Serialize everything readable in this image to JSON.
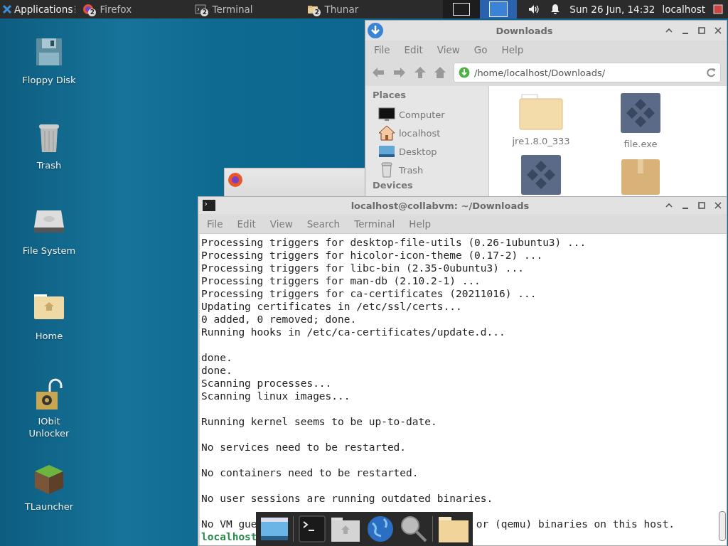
{
  "panel": {
    "applications": "Applications",
    "tasks": [
      {
        "label": "Firefox",
        "badge": "2",
        "kind": "firefox"
      },
      {
        "label": "Terminal",
        "badge": "2",
        "kind": "terminal"
      },
      {
        "label": "Thunar",
        "badge": "2",
        "kind": "folder"
      }
    ],
    "workspaces": [
      {
        "selected": false
      },
      {
        "selected": true
      }
    ],
    "clock": "Sun 26 Jun, 14:32",
    "user": "localhost"
  },
  "desktop_icons": [
    {
      "label": "Floppy Disk",
      "kind": "floppy"
    },
    {
      "label": "Trash",
      "kind": "trash"
    },
    {
      "label": "File System",
      "kind": "drive"
    },
    {
      "label": "Home",
      "kind": "home"
    },
    {
      "label": "IObit Unlocker",
      "kind": "unlocker"
    },
    {
      "label": "TLauncher",
      "kind": "block"
    }
  ],
  "thunar": {
    "title": "Downloads",
    "menu": [
      "File",
      "Edit",
      "View",
      "Go",
      "Help"
    ],
    "location": "/home/localhost/Downloads/",
    "sidebar": {
      "heading": "Places",
      "items": [
        {
          "label": "Computer",
          "kind": "computer"
        },
        {
          "label": "localhost",
          "kind": "home"
        },
        {
          "label": "Desktop",
          "kind": "desktop"
        },
        {
          "label": "Trash",
          "kind": "trash"
        }
      ],
      "heading_2": "Devices"
    },
    "files": [
      {
        "label": "jre1.8.0_333",
        "kind": "folder"
      },
      {
        "label": "file.exe",
        "kind": "exe"
      },
      {
        "kind": "exe"
      },
      {
        "kind": "archive"
      }
    ]
  },
  "terminal": {
    "title": "localhost@collabvm: ~/Downloads",
    "menu": [
      "File",
      "Edit",
      "View",
      "Search",
      "Terminal",
      "Help"
    ],
    "lines": [
      {
        "kind": "output",
        "text": "Processing triggers for desktop-file-utils (0.26-1ubuntu3) ..."
      },
      {
        "kind": "output",
        "text": "Processing triggers for hicolor-icon-theme (0.17-2) ..."
      },
      {
        "kind": "output",
        "text": "Processing triggers for libc-bin (2.35-0ubuntu3) ..."
      },
      {
        "kind": "output",
        "text": "Processing triggers for man-db (2.10.2-1) ..."
      },
      {
        "kind": "output",
        "text": "Processing triggers for ca-certificates (20211016) ..."
      },
      {
        "kind": "output",
        "text": "Updating certificates in /etc/ssl/certs..."
      },
      {
        "kind": "output",
        "text": "0 added, 0 removed; done."
      },
      {
        "kind": "output",
        "text": "Running hooks in /etc/ca-certificates/update.d..."
      },
      {
        "kind": "blank"
      },
      {
        "kind": "output",
        "text": "done."
      },
      {
        "kind": "output",
        "text": "done."
      },
      {
        "kind": "output",
        "text": "Scanning processes..."
      },
      {
        "kind": "output",
        "text": "Scanning linux images..."
      },
      {
        "kind": "blank"
      },
      {
        "kind": "output",
        "text": "Running kernel seems to be up-to-date."
      },
      {
        "kind": "blank"
      },
      {
        "kind": "output",
        "text": "No services need to be restarted."
      },
      {
        "kind": "blank"
      },
      {
        "kind": "output",
        "text": "No containers need to be restarted."
      },
      {
        "kind": "blank"
      },
      {
        "kind": "output",
        "text": "No user sessions are running outdated binaries."
      },
      {
        "kind": "blank"
      },
      {
        "kind": "split",
        "parts": [
          "No VM gue",
          "or (qemu) binaries on this host."
        ]
      },
      {
        "kind": "prompt",
        "text": "localhost"
      }
    ]
  }
}
